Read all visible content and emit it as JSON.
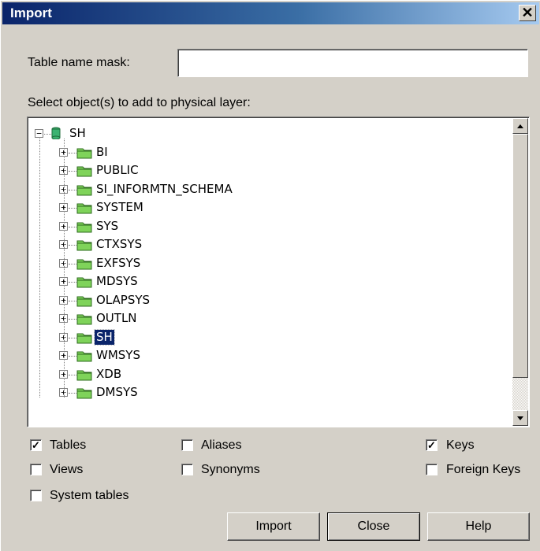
{
  "window": {
    "title": "Import",
    "close_label": "✕"
  },
  "mask": {
    "label": "Table name mask:",
    "value": ""
  },
  "tree": {
    "caption": "Select object(s) to add to physical layer:",
    "root": {
      "label": "SH",
      "expander": "−"
    },
    "children": [
      {
        "label": "BI",
        "expander": "+",
        "selected": false
      },
      {
        "label": "PUBLIC",
        "expander": "+",
        "selected": false
      },
      {
        "label": "SI_INFORMTN_SCHEMA",
        "expander": "+",
        "selected": false
      },
      {
        "label": "SYSTEM",
        "expander": "+",
        "selected": false
      },
      {
        "label": "SYS",
        "expander": "+",
        "selected": false
      },
      {
        "label": "CTXSYS",
        "expander": "+",
        "selected": false
      },
      {
        "label": "EXFSYS",
        "expander": "+",
        "selected": false
      },
      {
        "label": "MDSYS",
        "expander": "+",
        "selected": false
      },
      {
        "label": "OLAPSYS",
        "expander": "+",
        "selected": false
      },
      {
        "label": "OUTLN",
        "expander": "+",
        "selected": false
      },
      {
        "label": "SH",
        "expander": "+",
        "selected": true
      },
      {
        "label": "WMSYS",
        "expander": "+",
        "selected": false
      },
      {
        "label": "XDB",
        "expander": "+",
        "selected": false
      },
      {
        "label": "DMSYS",
        "expander": "+",
        "selected": false
      }
    ],
    "scroll_up": "▲",
    "scroll_down": "▼"
  },
  "options": {
    "tables": {
      "label": "Tables",
      "checked": true
    },
    "aliases": {
      "label": "Aliases",
      "checked": false
    },
    "keys": {
      "label": "Keys",
      "checked": true
    },
    "views": {
      "label": "Views",
      "checked": false
    },
    "synonyms": {
      "label": "Synonyms",
      "checked": false
    },
    "foreign_keys": {
      "label": "Foreign Keys",
      "checked": false
    },
    "system_tables": {
      "label": "System tables",
      "checked": false
    },
    "check_mark": "✓"
  },
  "buttons": {
    "import": "Import",
    "close": "Close",
    "help": "Help"
  },
  "colors": {
    "selection": "#0a246a",
    "folder": "#7fd35a",
    "db": "#3cb371",
    "face": "#d4d0c8"
  }
}
